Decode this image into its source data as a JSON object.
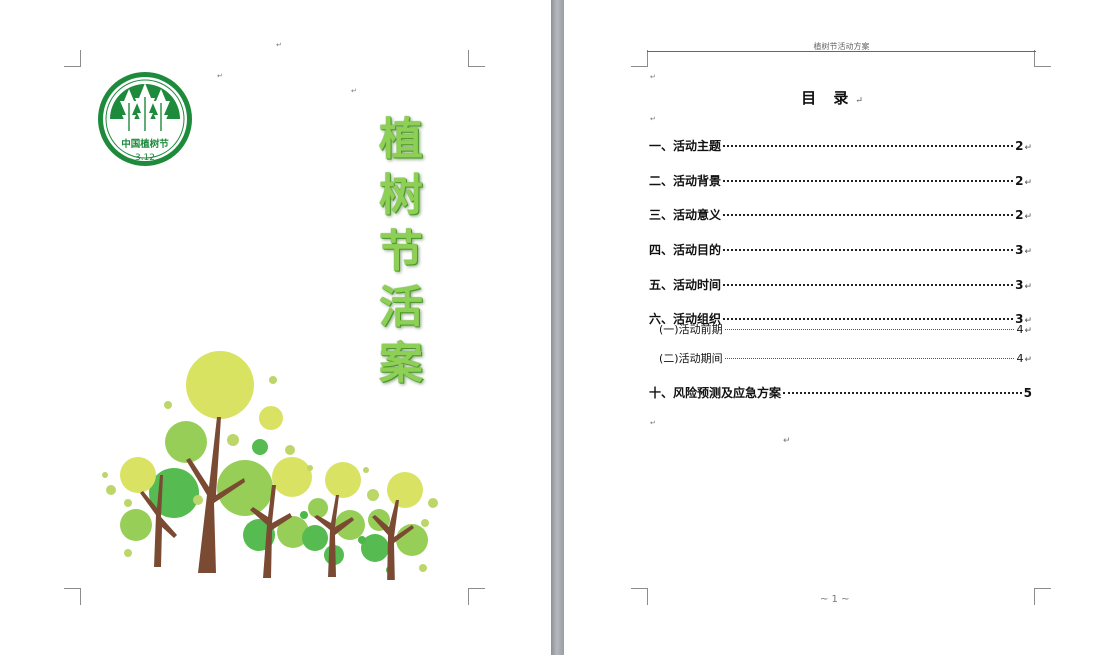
{
  "cover": {
    "logo": {
      "name": "中国植树节",
      "date": "3.12"
    },
    "title_chars": [
      "植",
      "树",
      "节",
      "活",
      "案"
    ]
  },
  "toc_page": {
    "header": "植树节活动方案",
    "heading": "目  录",
    "return_mark": "↵",
    "entries": [
      {
        "label": "一、活动主题",
        "page": "2"
      },
      {
        "label": "二、活动背景",
        "page": "2"
      },
      {
        "label": "三、活动意义",
        "page": "2"
      },
      {
        "label": "四、活动目的",
        "page": "3"
      },
      {
        "label": "五、活动时间",
        "page": "3"
      },
      {
        "label": "六、活动组织",
        "page": "3"
      },
      {
        "label": "(一)活动前期",
        "page": "4"
      },
      {
        "label": "(二)活动期间",
        "page": "4"
      },
      {
        "label": "十、风险预测及应急方案",
        "page": "5"
      }
    ],
    "footer": "~ 1 ~"
  },
  "colors": {
    "logo_green": "#1e8a3c",
    "title_green": "#8ecf55",
    "trunk": "#7a4a33"
  }
}
